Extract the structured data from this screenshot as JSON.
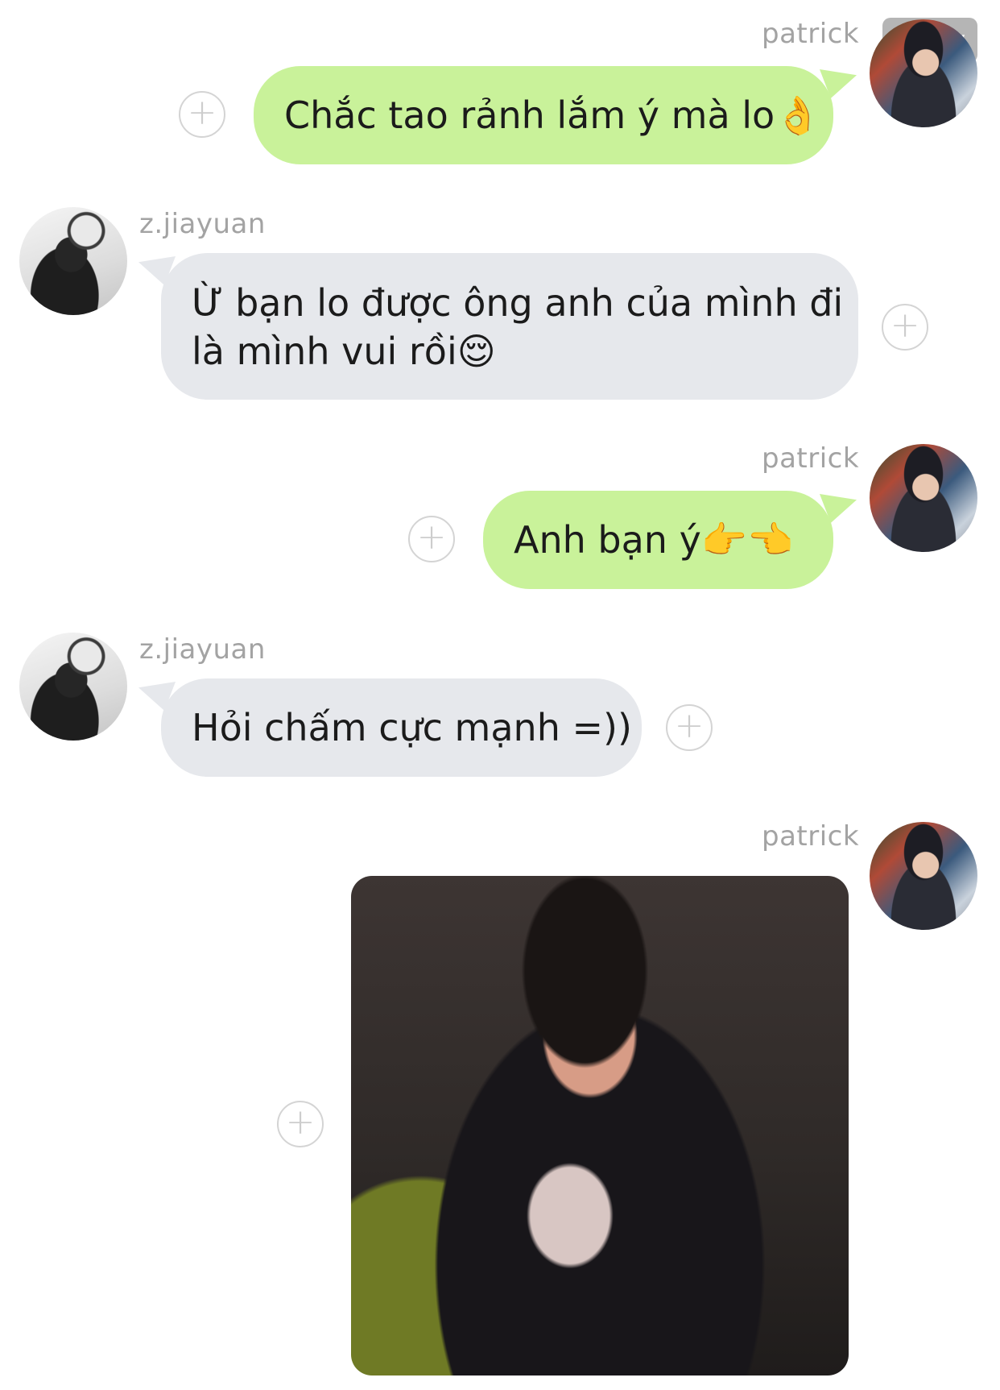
{
  "watermark": "91joy",
  "messages": [
    {
      "sender": "patrick",
      "text": "Chắc tao rảnh lắm ý mà lo👌",
      "direction": "outgoing"
    },
    {
      "sender": "z.jiayuan",
      "text": "Ừ bạn lo được ông anh của mình đi\nlà mình vui rồi😌",
      "direction": "incoming"
    },
    {
      "sender": "patrick",
      "text": "Anh bạn ý👉👈",
      "direction": "outgoing"
    },
    {
      "sender": "z.jiayuan",
      "text": "Hỏi chấm cực mạnh =))",
      "direction": "incoming"
    },
    {
      "sender": "patrick",
      "image": "photo-of-young-man-in-dark-jacket-and-striped-tie",
      "direction": "outgoing"
    }
  ],
  "icons": {
    "add": "+"
  },
  "colors": {
    "outgoing_bubble": "#c9f29a",
    "incoming_bubble": "#e6e8ec",
    "username": "#a3a3a3",
    "background": "#ffffff"
  }
}
